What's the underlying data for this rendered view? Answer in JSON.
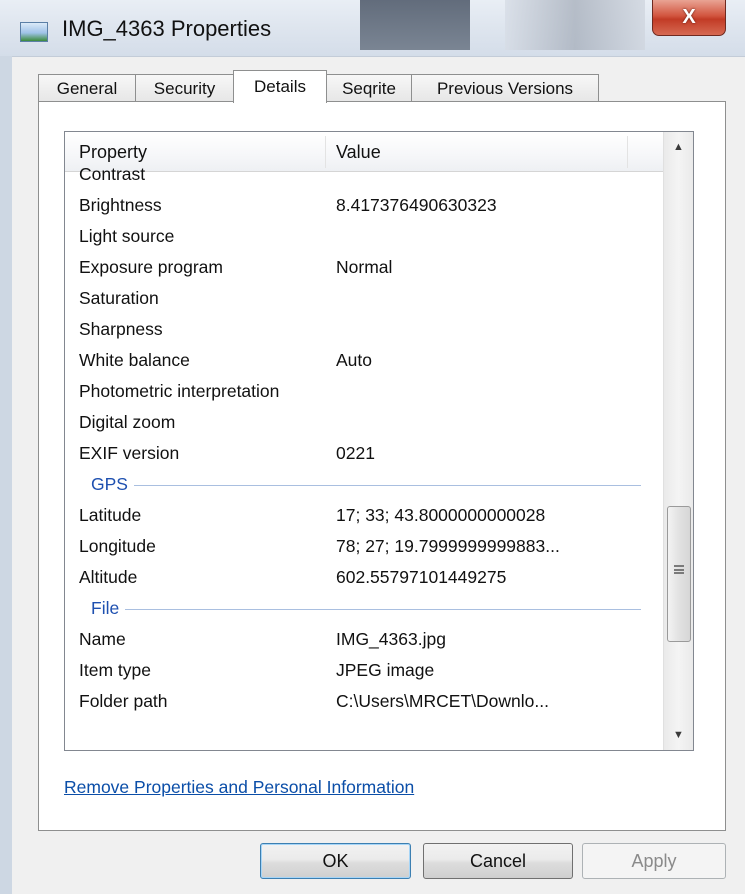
{
  "window": {
    "title": "IMG_4363 Properties",
    "close_label": "X"
  },
  "tabs": [
    {
      "label": "General"
    },
    {
      "label": "Security"
    },
    {
      "label": "Details"
    },
    {
      "label": "Seqrite"
    },
    {
      "label": "Previous Versions"
    }
  ],
  "list": {
    "columns": {
      "property": "Property",
      "value": "Value"
    },
    "rows": [
      {
        "name": "Contrast",
        "value": ""
      },
      {
        "name": "Brightness",
        "value": "8.417376490630323"
      },
      {
        "name": "Light source",
        "value": ""
      },
      {
        "name": "Exposure program",
        "value": "Normal"
      },
      {
        "name": "Saturation",
        "value": ""
      },
      {
        "name": "Sharpness",
        "value": ""
      },
      {
        "name": "White balance",
        "value": "Auto"
      },
      {
        "name": "Photometric interpretation",
        "value": ""
      },
      {
        "name": "Digital zoom",
        "value": ""
      },
      {
        "name": "EXIF version",
        "value": "0221"
      }
    ],
    "groups": {
      "gps": {
        "label": "GPS",
        "rows": [
          {
            "name": "Latitude",
            "value": "17; 33; 43.8000000000028"
          },
          {
            "name": "Longitude",
            "value": "78; 27; 19.7999999999883..."
          },
          {
            "name": "Altitude",
            "value": "602.55797101449275"
          }
        ]
      },
      "file": {
        "label": "File",
        "rows": [
          {
            "name": "Name",
            "value": "IMG_4363.jpg"
          },
          {
            "name": "Item type",
            "value": "JPEG image"
          },
          {
            "name": "Folder path",
            "value": "C:\\Users\\MRCET\\Downlo..."
          }
        ]
      }
    }
  },
  "remove_link": "Remove Properties and Personal Information",
  "buttons": {
    "ok": "OK",
    "cancel": "Cancel",
    "apply": "Apply"
  },
  "scrollbar": {
    "up_glyph": "▲",
    "down_glyph": "▼"
  }
}
